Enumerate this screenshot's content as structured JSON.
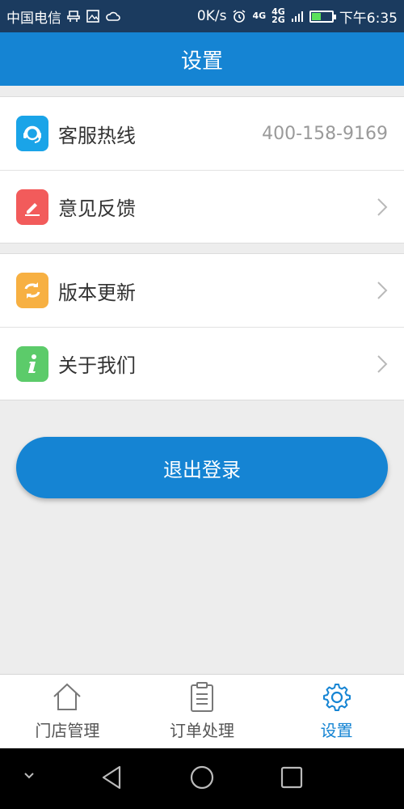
{
  "status_bar": {
    "carrier": "中国电信",
    "speed": "0K/s",
    "net_primary": "4G",
    "net_secondary_top": "4G",
    "net_secondary_bottom": "2G",
    "time": "下午6:35"
  },
  "header": {
    "title": "设置"
  },
  "settings": {
    "group1": [
      {
        "label": "客服热线",
        "value": "400-158-9169",
        "icon": "headset-icon",
        "color": "#1aa4e8"
      },
      {
        "label": "意见反馈",
        "icon": "pencil-icon",
        "color": "#f25b5b"
      }
    ],
    "group2": [
      {
        "label": "版本更新",
        "icon": "refresh-icon",
        "color": "#f7b042"
      },
      {
        "label": "关于我们",
        "icon": "info-icon",
        "color": "#5ccb6a"
      }
    ]
  },
  "logout": {
    "label": "退出登录"
  },
  "tabs": [
    {
      "label": "门店管理",
      "icon": "home-icon"
    },
    {
      "label": "订单处理",
      "icon": "clipboard-icon"
    },
    {
      "label": "设置",
      "icon": "gear-icon",
      "active": true
    }
  ],
  "colors": {
    "accent": "#1584d3",
    "status_bar": "#1b3b5f"
  }
}
